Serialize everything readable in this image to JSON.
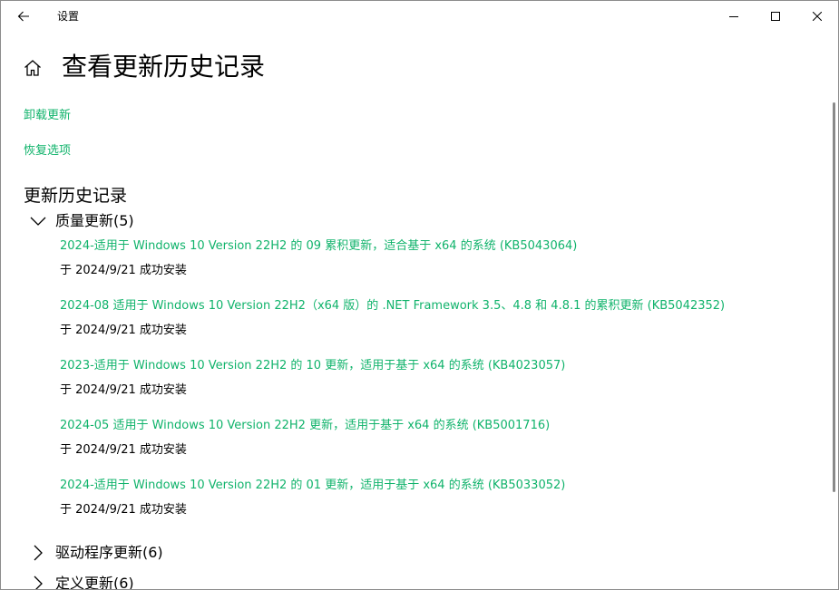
{
  "window": {
    "title": "设置"
  },
  "header": {
    "page_title": "查看更新历史记录"
  },
  "links": {
    "uninstall": "卸载更新",
    "recovery": "恢复选项"
  },
  "history": {
    "section_title": "更新历史记录",
    "groups": [
      {
        "label": "质量更新(5)",
        "expanded": true,
        "items": [
          {
            "title": "2024-适用于 Windows 10 Version 22H2 的 09 累积更新，适合基于 x64 的系统 (KB5043064)",
            "status": "于 2024/9/21 成功安装"
          },
          {
            "title": "2024-08 适用于 Windows 10 Version 22H2（x64 版）的 .NET Framework 3.5、4.8 和 4.8.1 的累积更新 (KB5042352)",
            "status": "于 2024/9/21 成功安装"
          },
          {
            "title": "2023-适用于 Windows 10 Version 22H2 的 10 更新，适用于基于 x64 的系统 (KB4023057)",
            "status": "于 2024/9/21 成功安装"
          },
          {
            "title": "2024-05 适用于 Windows 10 Version 22H2 更新，适用于基于 x64 的系统 (KB5001716)",
            "status": "于 2024/9/21 成功安装"
          },
          {
            "title": "2024-适用于 Windows 10 Version 22H2 的 01 更新，适用于基于 x64 的系统 (KB5033052)",
            "status": "于 2024/9/21 成功安装"
          }
        ]
      },
      {
        "label": "驱动程序更新(6)",
        "expanded": false
      },
      {
        "label": "定义更新(6)",
        "expanded": false
      }
    ]
  },
  "colors": {
    "accent": "#10b36b",
    "text": "#000000",
    "background": "#ffffff"
  },
  "icons": {
    "back": "back-arrow-icon",
    "home": "home-icon",
    "minimize": "minimize-icon",
    "maximize": "maximize-icon",
    "close": "close-icon",
    "expanded": "chevron-down-icon",
    "collapsed": "chevron-right-icon"
  }
}
